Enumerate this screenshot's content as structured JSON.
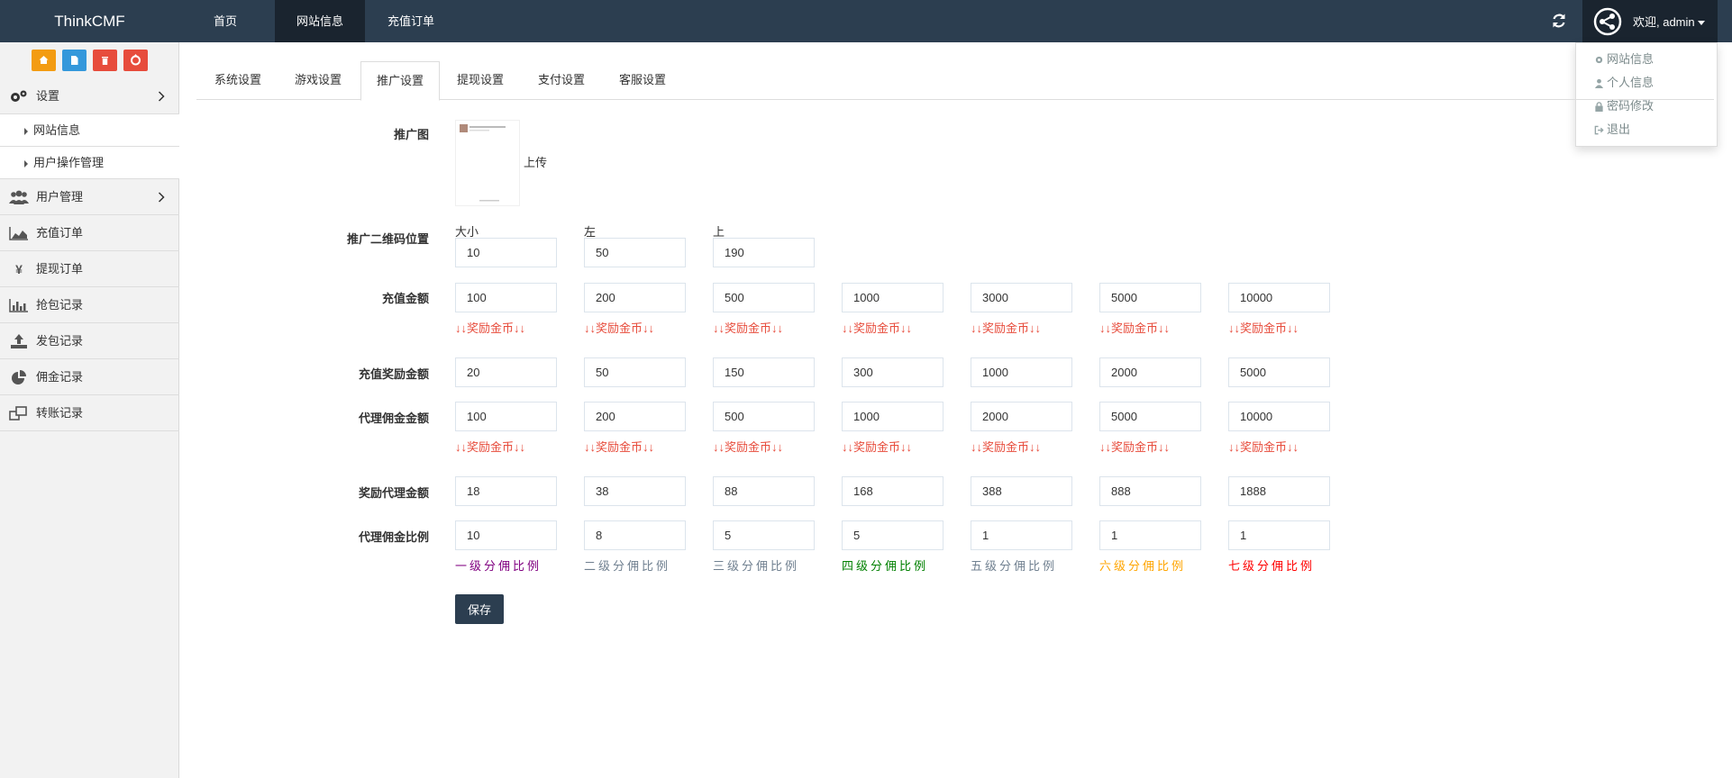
{
  "navbar": {
    "brand": "ThinkCMF",
    "items": [
      "首页",
      "网站信息",
      "充值订单"
    ],
    "active_index": 1,
    "user_welcome": "欢迎, admin",
    "dropdown": [
      "网站信息",
      "个人信息",
      "密码修改",
      "退出"
    ]
  },
  "sidebar": {
    "shortcut_colors": [
      "#f39c12",
      "#3498db",
      "#e74c3c",
      "#e74c3c"
    ],
    "groups": [
      {
        "label": "设置",
        "icon": "gears-icon",
        "expanded": true,
        "children": [
          "网站信息",
          "用户操作管理"
        ]
      },
      {
        "label": "用户管理",
        "icon": "users-icon",
        "expanded": false
      },
      {
        "label": "充值订单",
        "icon": "area-chart-icon"
      },
      {
        "label": "提现订单",
        "icon": "yen-icon"
      },
      {
        "label": "抢包记录",
        "icon": "bar-chart-icon"
      },
      {
        "label": "发包记录",
        "icon": "upload-icon"
      },
      {
        "label": "佣金记录",
        "icon": "pie-chart-icon"
      },
      {
        "label": "转账记录",
        "icon": "windows-icon"
      }
    ]
  },
  "tabs": [
    "系统设置",
    "游戏设置",
    "推广设置",
    "提现设置",
    "支付设置",
    "客服设置"
  ],
  "active_tab": 2,
  "form": {
    "promo_image": {
      "label": "推广图",
      "upload_label": "上传"
    },
    "qr_position": {
      "label": "推广二维码位置",
      "fields": [
        {
          "label": "大小",
          "value": "10"
        },
        {
          "label": "左",
          "value": "50"
        },
        {
          "label": "上",
          "value": "190"
        }
      ]
    },
    "recharge_amount": {
      "label": "充值金额",
      "values": [
        "100",
        "200",
        "500",
        "1000",
        "3000",
        "5000",
        "10000"
      ]
    },
    "reward_hint": "↓↓奖励金币↓↓",
    "recharge_reward": {
      "label": "充值奖励金额",
      "values": [
        "20",
        "50",
        "150",
        "300",
        "1000",
        "2000",
        "5000"
      ]
    },
    "agent_commission": {
      "label": "代理佣金金额",
      "values": [
        "100",
        "200",
        "500",
        "1000",
        "2000",
        "5000",
        "10000"
      ]
    },
    "agent_reward": {
      "label": "奖励代理金额",
      "values": [
        "18",
        "38",
        "88",
        "168",
        "388",
        "888",
        "1888"
      ]
    },
    "commission_ratio": {
      "label": "代理佣金比例",
      "values": [
        "10",
        "8",
        "5",
        "5",
        "1",
        "1",
        "1"
      ],
      "tiers": [
        "一级分佣比例",
        "二级分佣比例",
        "三级分佣比例",
        "四级分佣比例",
        "五级分佣比例",
        "六级分佣比例",
        "七级分佣比例"
      ],
      "tier_colors": [
        "#800080",
        "#708090",
        "#708090",
        "#008000",
        "#708090",
        "#ffa500",
        "#ff0000"
      ]
    },
    "save_label": "保存"
  }
}
